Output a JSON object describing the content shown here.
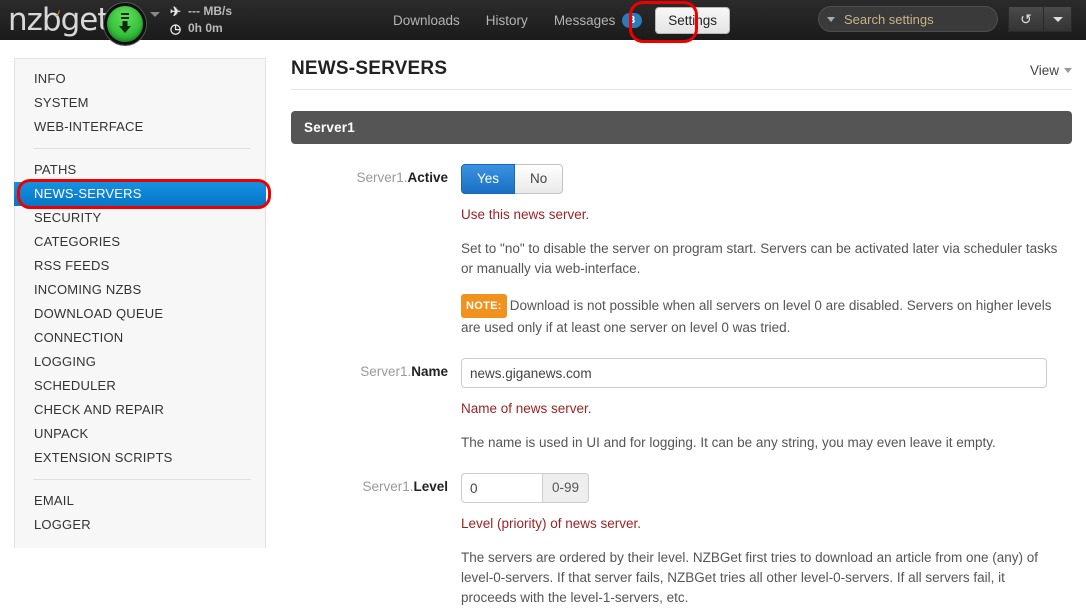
{
  "navbar": {
    "brand": "nzbget",
    "brand_icon": "wifi-arc-icon",
    "download_button_icon": "download-circle-icon",
    "brand_caret_icon": "caret-down-icon",
    "stats": {
      "speed_icon": "plane-icon",
      "speed": "--- MB/s",
      "time_icon": "clock-icon",
      "time": "0h 0m"
    },
    "links": [
      {
        "label": "Downloads",
        "active": false
      },
      {
        "label": "History",
        "active": false
      },
      {
        "label": "Messages",
        "badge": "3",
        "active": false
      },
      {
        "label": "Settings",
        "active": true
      }
    ],
    "search": {
      "caret_icon": "caret-down-icon",
      "placeholder": "Search settings",
      "value": "",
      "clear_icon": "close-x-icon"
    },
    "refresh_icon": "refresh-icon",
    "refresh_caret_icon": "caret-down-icon"
  },
  "sidebar": {
    "groups": [
      {
        "items": [
          {
            "label": "INFO",
            "active": false
          },
          {
            "label": "SYSTEM",
            "active": false
          },
          {
            "label": "WEB-INTERFACE",
            "active": false
          }
        ]
      },
      {
        "items": [
          {
            "label": "PATHS",
            "active": false
          },
          {
            "label": "NEWS-SERVERS",
            "active": true
          },
          {
            "label": "SECURITY",
            "active": false
          },
          {
            "label": "CATEGORIES",
            "active": false
          },
          {
            "label": "RSS FEEDS",
            "active": false
          },
          {
            "label": "INCOMING NZBS",
            "active": false
          },
          {
            "label": "DOWNLOAD QUEUE",
            "active": false
          },
          {
            "label": "CONNECTION",
            "active": false
          },
          {
            "label": "LOGGING",
            "active": false
          },
          {
            "label": "SCHEDULER",
            "active": false
          },
          {
            "label": "CHECK AND REPAIR",
            "active": false
          },
          {
            "label": "UNPACK",
            "active": false
          },
          {
            "label": "EXTENSION SCRIPTS",
            "active": false
          }
        ]
      },
      {
        "items": [
          {
            "label": "EMAIL",
            "active": false
          },
          {
            "label": "LOGGER",
            "active": false
          }
        ]
      }
    ]
  },
  "main": {
    "page_title": "NEWS-SERVERS",
    "view_menu": {
      "label": "View",
      "caret_icon": "caret-down-icon"
    },
    "section_title": "Server1",
    "fields": {
      "active": {
        "label_prefix": "Server1.",
        "label_name": "Active",
        "options": [
          {
            "label": "Yes",
            "selected": true
          },
          {
            "label": "No",
            "selected": false
          }
        ],
        "help_red": "Use this news server.",
        "help_gray": "Set to \"no\" to disable the server on program start. Servers can be activated later via scheduler tasks or manually via web-interface.",
        "note_badge": "NOTE:",
        "note_text": "Download is not possible when all servers on level 0 are disabled. Servers on higher levels are used only if at least one server on level 0 was tried."
      },
      "name": {
        "label_prefix": "Server1.",
        "label_name": "Name",
        "value": "news.giganews.com",
        "help_red": "Name of news server.",
        "help_gray": "The name is used in UI and for logging. It can be any string, you may even leave it empty."
      },
      "level": {
        "label_prefix": "Server1.",
        "label_name": "Level",
        "value": "0",
        "addon": "0-99",
        "help_red": "Level (priority) of news server.",
        "help_gray": "The servers are ordered by their level. NZBGet first tries to download an article from one (any) of level-0-servers. If that server fails, NZBGet tries all other level-0-servers. If all servers fail, it proceeds with the level-1-servers, etc."
      }
    }
  },
  "annotations": {
    "ring_color": "#ee0000",
    "targets": [
      "settings-tab",
      "sidebar-item-news-servers"
    ]
  }
}
